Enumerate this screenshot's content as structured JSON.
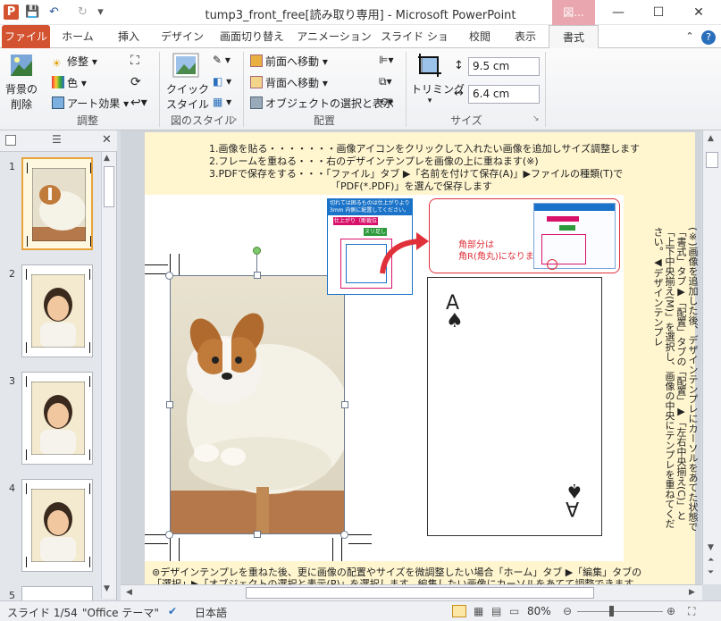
{
  "window": {
    "title": "tump3_front_free[読み取り専用] - Microsoft PowerPoint",
    "context_tab": "図...",
    "controls": {
      "minimize": "—",
      "maximize": "☐",
      "close": "✕"
    }
  },
  "quick_access": {
    "app_icon": "P",
    "save": "💾",
    "undo": "↶",
    "redo": "↻",
    "more": "▾"
  },
  "tabs": [
    "ファイル",
    "ホーム",
    "挿入",
    "デザイン",
    "画面切り替え",
    "アニメーション",
    "スライド ショー",
    "校閲",
    "表示",
    "書式"
  ],
  "ribbon": {
    "remove_bg_l1": "背景の",
    "remove_bg_l2": "削除",
    "corrections": "修整",
    "color": "色",
    "art_effects": "アート効果",
    "group_adjust": "調整",
    "quick_styles_l1": "クイック",
    "quick_styles_l2": "スタイル",
    "group_styles": "図のスタイル",
    "bring_forward": "前面へ移動",
    "send_backward": "背面へ移動",
    "selection_pane": "オブジェクトの選択と表示",
    "group_arrange": "配置",
    "crop": "トリミング",
    "height": "9.5 cm",
    "width": "6.4 cm",
    "group_size": "サイズ"
  },
  "slides_pane": {
    "numbers": [
      "1",
      "2",
      "3",
      "4",
      "5"
    ]
  },
  "slide": {
    "instructions": [
      "1.画像を貼る・・・・・・・画像アイコンをクリックして入れたい画像を追加しサイズ調整します",
      "2.フレームを重ねる・・・右のデザインテンプレを画像の上に重ねます(※)",
      "3.PDFで保存をする・・・「ファイル」タブ ▶「名前を付けて保存(A)」▶ファイルの種類(T)で",
      "「PDF(*.PDF)」を選んで保存します"
    ],
    "guide_box_title": "切れては困るものは仕上がりより3mm 内側に配置してください。",
    "guide_finish": "仕上がり（断裁位置）",
    "guide_bleed": "ヌリ足し",
    "corner_note_l1": "角部分は",
    "corner_note_l2": "角R(角丸)になります↘",
    "card_rank": "A",
    "card_suit": "♠",
    "vertical_note": "(※)画像を追加した後、デザインテンプレにカーソルをあてた状態で「書式」タブ▶「配置」タブの「配置」▶「左右中央揃え(C)」と「上下中央揃え(M)」を選択し、画像の中央にテンプレを重ねてください。◀デザインテンプレ",
    "bottom_note_l1": "⊚デザインテンプレを重ねた後、更に画像の配置やサイズを微調整したい場合「ホーム」タブ ▶「編集」タブの",
    "bottom_note_l2": "「選択」▶「オブジェクトの選択と表示(P)」を選択します。編集したい画像にカーソルをあてて調整できます。"
  },
  "status": {
    "slide": "スライド 1/54",
    "theme": "\"Office テーマ\"",
    "language": "日本語",
    "zoom": "80%"
  },
  "colors": {
    "file_tab": "#d35230",
    "context": "#e9a6ae",
    "slide_bg": "#fff5cf",
    "accent_red": "#e0303a",
    "guide_blue": "#1a73c8"
  }
}
